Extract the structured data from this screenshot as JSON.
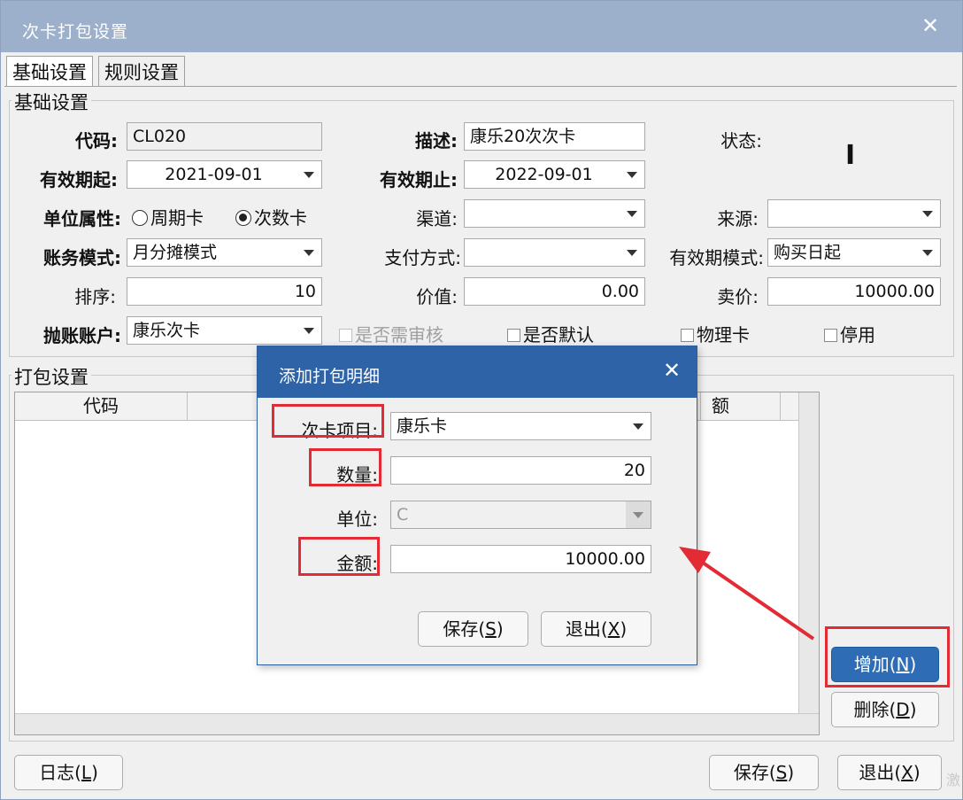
{
  "window": {
    "title": "次卡打包设置"
  },
  "tabs": [
    {
      "label": "基础设置"
    },
    {
      "label": "规则设置"
    }
  ],
  "basic": {
    "group_title": "基础设置",
    "code_label": "代码:",
    "code_value": "CL020",
    "desc_label": "描述:",
    "desc_value": "康乐20次次卡",
    "status_label": "状态:",
    "status_value": "I",
    "valid_from_label": "有效期起:",
    "valid_from_value": "2021-09-01",
    "valid_to_label": "有效期止:",
    "valid_to_value": "2022-09-01",
    "unit_attr_label": "单位属性:",
    "radio_period": "周期卡",
    "radio_count": "次数卡",
    "channel_label": "渠道:",
    "channel_value": "",
    "source_label": "来源:",
    "source_value": "",
    "account_mode_label": "账务模式:",
    "account_mode_value": "月分摊模式",
    "pay_method_label": "支付方式:",
    "pay_method_value": "",
    "validity_mode_label": "有效期模式:",
    "validity_mode_value": "购买日起",
    "sort_label": "排序:",
    "sort_value": "10",
    "value_label": "价值:",
    "value_value": "0.00",
    "price_label": "卖价:",
    "price_value": "10000.00",
    "ledger_label": "抛账账户:",
    "ledger_value": "康乐次卡",
    "chk_review": "是否需审核",
    "chk_default": "是否默认",
    "chk_physical": "物理卡",
    "chk_disabled": "停用"
  },
  "package": {
    "group_title": "打包设置",
    "columns": [
      "代码",
      "",
      "额"
    ],
    "add_button": "增加",
    "add_key": "N",
    "delete_button": "删除",
    "delete_key": "D"
  },
  "dialog": {
    "title": "添加打包明细",
    "item_label": "次卡项目:",
    "item_value": "康乐卡",
    "qty_label": "数量:",
    "qty_value": "20",
    "unit_label": "单位:",
    "unit_value": "C",
    "amount_label": "金额:",
    "amount_value": "10000.00",
    "save_button": "保存",
    "save_key": "S",
    "exit_button": "退出",
    "exit_key": "X"
  },
  "footer": {
    "log_button": "日志",
    "log_key": "L",
    "save_button": "保存",
    "save_key": "S",
    "exit_button": "退出",
    "exit_key": "X"
  },
  "colors": {
    "title_bar": "#9db0cb",
    "dialog_title_bar": "#2e63a8",
    "primary_button": "#2e6db5",
    "highlight_red": "#e32b35"
  }
}
